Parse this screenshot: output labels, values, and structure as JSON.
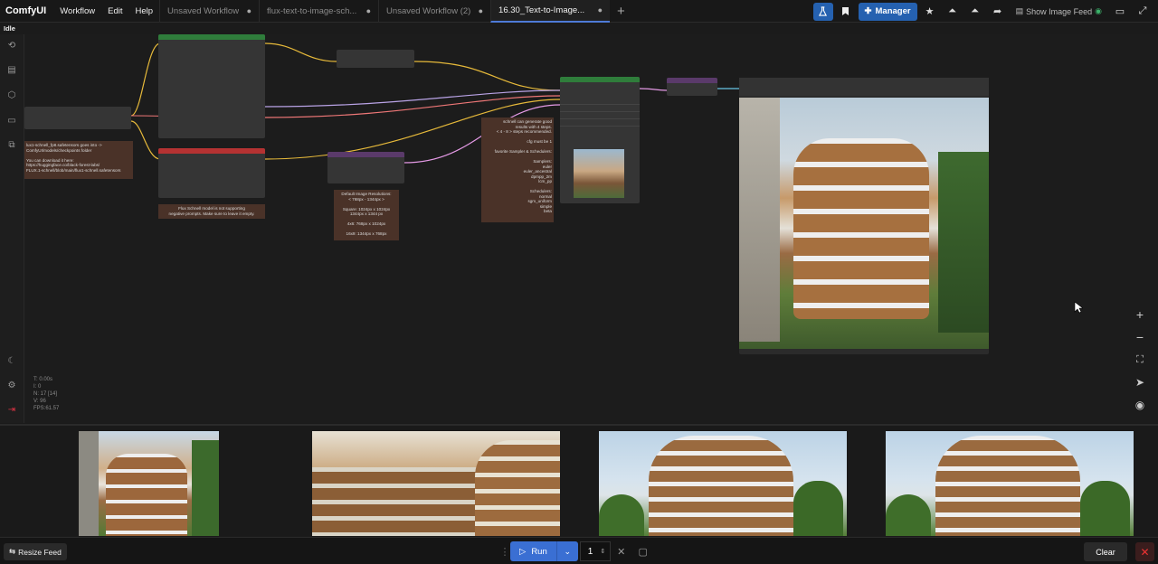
{
  "app": {
    "brand": "ComfyUI",
    "menu": [
      "Workflow",
      "Edit",
      "Help"
    ],
    "status": "Idle"
  },
  "tabs": [
    {
      "label": "Unsaved Workflow",
      "active": false
    },
    {
      "label": "flux-text-to-image-sch...",
      "active": false
    },
    {
      "label": "Unsaved Workflow (2)",
      "active": false
    },
    {
      "label": "16.30_Text-to-Image...",
      "active": true
    }
  ],
  "toolbar": {
    "manager_label": "Manager",
    "feed_toggle_label": "Show Image Feed",
    "accent_color": "#2561b0"
  },
  "notes": {
    "checkpoint_note": "lux1-schnell_fp8.safetensors goes into ->\nComfyUI/models/checkpoints folder\n\nYou can download it here:\nhttps://huggingface.co/black-forest-labs/\nFLUX.1-schnell/blob/main/flux1-schnell.safetensors",
    "negative_note": "Flux Schnell model is not supporting\nnegative prompts. Make sure to leave it empty.",
    "resolution_note": "Default Image Resolutions:\n< 768px - 1344px >\n\nSquare: 1024px x 1024px\n1344px x 1344 px\n\n4x6: 768px x 1024px\n\n16x9: 1344px x 768px",
    "sampler_note": "schnell can generate good\nresults with 4 steps.\n< 4 - 8 > steps recommended.\n\ncfg must be 1\n\nfavorite Sampler & Schedulers:\n\nSamplers:\neuler\neuler_ancestral\ndpmpp_2m\nlcm_pp\n\nSchedulers:\nnormal\nsgm_uniform\nsimple\nbeta"
  },
  "stats": {
    "lines": [
      "T: 0.00s",
      "I: 0",
      "N: 17 [14]",
      "V: 96",
      "FPS:61.57"
    ]
  },
  "bottom": {
    "resize_label": "Resize Feed",
    "run_label": "Run",
    "batch_count": "1",
    "clear_label": "Clear"
  }
}
